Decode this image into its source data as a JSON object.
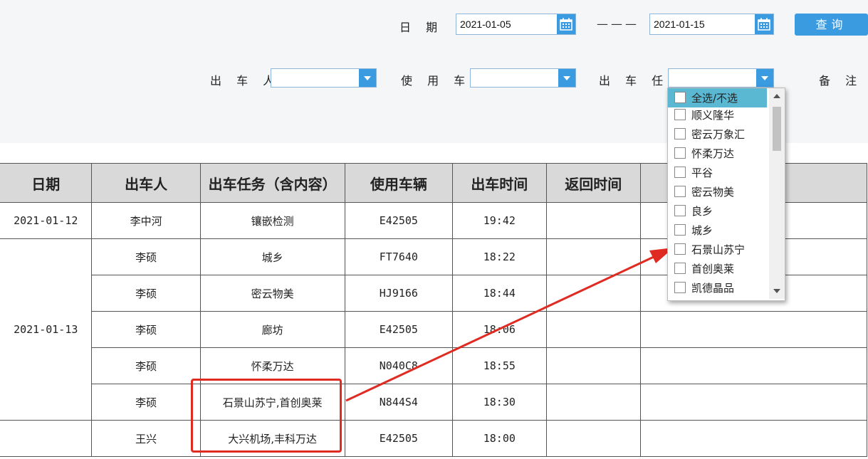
{
  "filters": {
    "date_label": "日 期",
    "date_from": "2021-01-05",
    "date_sep": "———",
    "date_to": "2021-01-15",
    "query_label": "查询",
    "driver_label": "出 车 人",
    "vehicle_label": "使 用 车 辆",
    "task_label": "出 车 任 务",
    "remark_label": "备 注",
    "driver_value": "",
    "vehicle_value": "",
    "task_value": ""
  },
  "task_dropdown": {
    "items": [
      {
        "label": "全选/不选",
        "selected": true
      },
      {
        "label": "顺义隆华"
      },
      {
        "label": "密云万象汇"
      },
      {
        "label": "怀柔万达"
      },
      {
        "label": "平谷"
      },
      {
        "label": "密云物美"
      },
      {
        "label": "良乡"
      },
      {
        "label": "城乡"
      },
      {
        "label": "石景山苏宁"
      },
      {
        "label": "首创奥莱"
      },
      {
        "label": "凯德晶品"
      }
    ]
  },
  "table": {
    "headers": [
      "日期",
      "出车人",
      "出车任务（含内容）",
      "使用车辆",
      "出车时间",
      "返回时间",
      ""
    ],
    "rows": [
      {
        "date": "2021-01-12",
        "driver": "李中河",
        "task": "镶嵌检测",
        "vehicle": "E42505",
        "depart": "19:42",
        "return": "",
        "remark": ""
      },
      {
        "date": "2021-01-13",
        "driver": "李硕",
        "task": "城乡",
        "vehicle": "FT7640",
        "depart": "18:22",
        "return": "",
        "remark": ""
      },
      {
        "date": "",
        "driver": "李硕",
        "task": "密云物美",
        "vehicle": "HJ9166",
        "depart": "18:44",
        "return": "",
        "remark": ""
      },
      {
        "date": "",
        "driver": "李硕",
        "task": "廊坊",
        "vehicle": "E42505",
        "depart": "18:06",
        "return": "",
        "remark": ""
      },
      {
        "date": "",
        "driver": "李硕",
        "task": "怀柔万达",
        "vehicle": "N040C8",
        "depart": "18:55",
        "return": "",
        "remark": ""
      },
      {
        "date": "",
        "driver": "李硕",
        "task": "石景山苏宁,首创奥莱",
        "vehicle": "N844S4",
        "depart": "18:30",
        "return": "",
        "remark": ""
      },
      {
        "date": "",
        "driver": "王兴",
        "task": "大兴机场,丰科万达",
        "vehicle": "E42505",
        "depart": "18:00",
        "return": "",
        "remark": ""
      }
    ]
  },
  "colors": {
    "accent": "#3a9be0",
    "annotation": "#e02b22",
    "selected_item": "#5bb8d3"
  },
  "icons": {
    "calendar": "calendar-icon",
    "dropdown": "chevron-down-icon"
  }
}
